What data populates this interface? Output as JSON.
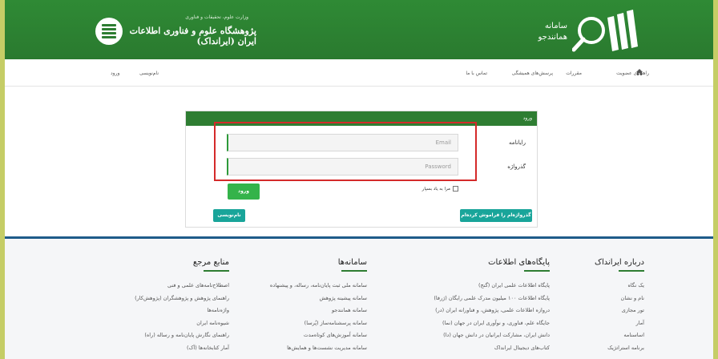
{
  "header": {
    "institute_small": "وزارت علوم، تحقیقات و فناوری",
    "institute_name": "پژوهشگاه علوم و فناوری اطلاعات ایران (ایرانداک)",
    "system_line1": "سامانه",
    "system_line2": "همانندجو"
  },
  "nav": {
    "items": [
      "راهنمای عضویت",
      "مقررات",
      "پرسش‌های همیشگی",
      "تماس با ما"
    ],
    "register": "نام‌نویسی",
    "login": "ورود"
  },
  "login_panel": {
    "title": "ورود",
    "username_label": "رایانامه",
    "password_label": "گذرواژه",
    "email_placeholder": "Email",
    "password_placeholder": "Password",
    "remember_label": "مرا به یاد بسپار",
    "login_button": "ورود",
    "register_button": "نام‌نویسی",
    "forgot_button": "گذرواژه‌ام را فراموش کرده‌ام"
  },
  "footer": {
    "about": {
      "title": "درباره ایرانداک",
      "links": [
        "یک نگاه",
        "نام و نشان",
        "تور مجازی",
        "آمار",
        "اساسنامه",
        "برنامه استراتژیک"
      ]
    },
    "databases": {
      "title": "پایگاه‌های اطلاعات",
      "links": [
        "پایگاه اطلاعات علمی ایران (گنج)",
        "پایگاه اطلاعات ۱۰۰ میلیون مدرک علمی رایگان (ژرفا)",
        "دروازه اطلاعات علمی، پژوهش، و فناورانه ایران (در)",
        "جایگاه علم، فناوری، و نوآوری ایران در جهان (نما)",
        "دانش ایران، مشارکت ایرانیان در دانش جهان (دا)",
        "کتاب‌های دیجیتال ایرانداک"
      ]
    },
    "systems": {
      "title": "سامانه‌ها",
      "links": [
        "سامانه ملی ثبت پایان‌نامه، رساله، و پیشنهاده",
        "سامانه پیشینه پژوهش",
        "سامانه همانندجو",
        "سامانه پرسشنامه‌ساز (پُرسا)",
        "سامانه آموزش‌های کوتاه‌مدت",
        "سامانه مدیریت نشست‌ها و همایش‌ها"
      ]
    },
    "references": {
      "title": "منابع مرجع",
      "links": [
        "اصطلاح‌نامه‌های علمی و فنی",
        "راهنمای پژوهش و پژوهشگران (پژوهش‌کار)",
        "واژه‌نامه‌ها",
        "شیوه‌نامه ایران",
        "راهنمای نگارش پایان‌نامه و رساله (راه)",
        "آمار کتابخانه‌ها (آک)"
      ]
    }
  },
  "colors": {
    "header_green": "#2e7d32",
    "button_green": "#34b34a",
    "button_teal": "#19a59a",
    "highlight_red": "#d42a2a",
    "footer_rule": "#1f5c8a"
  }
}
